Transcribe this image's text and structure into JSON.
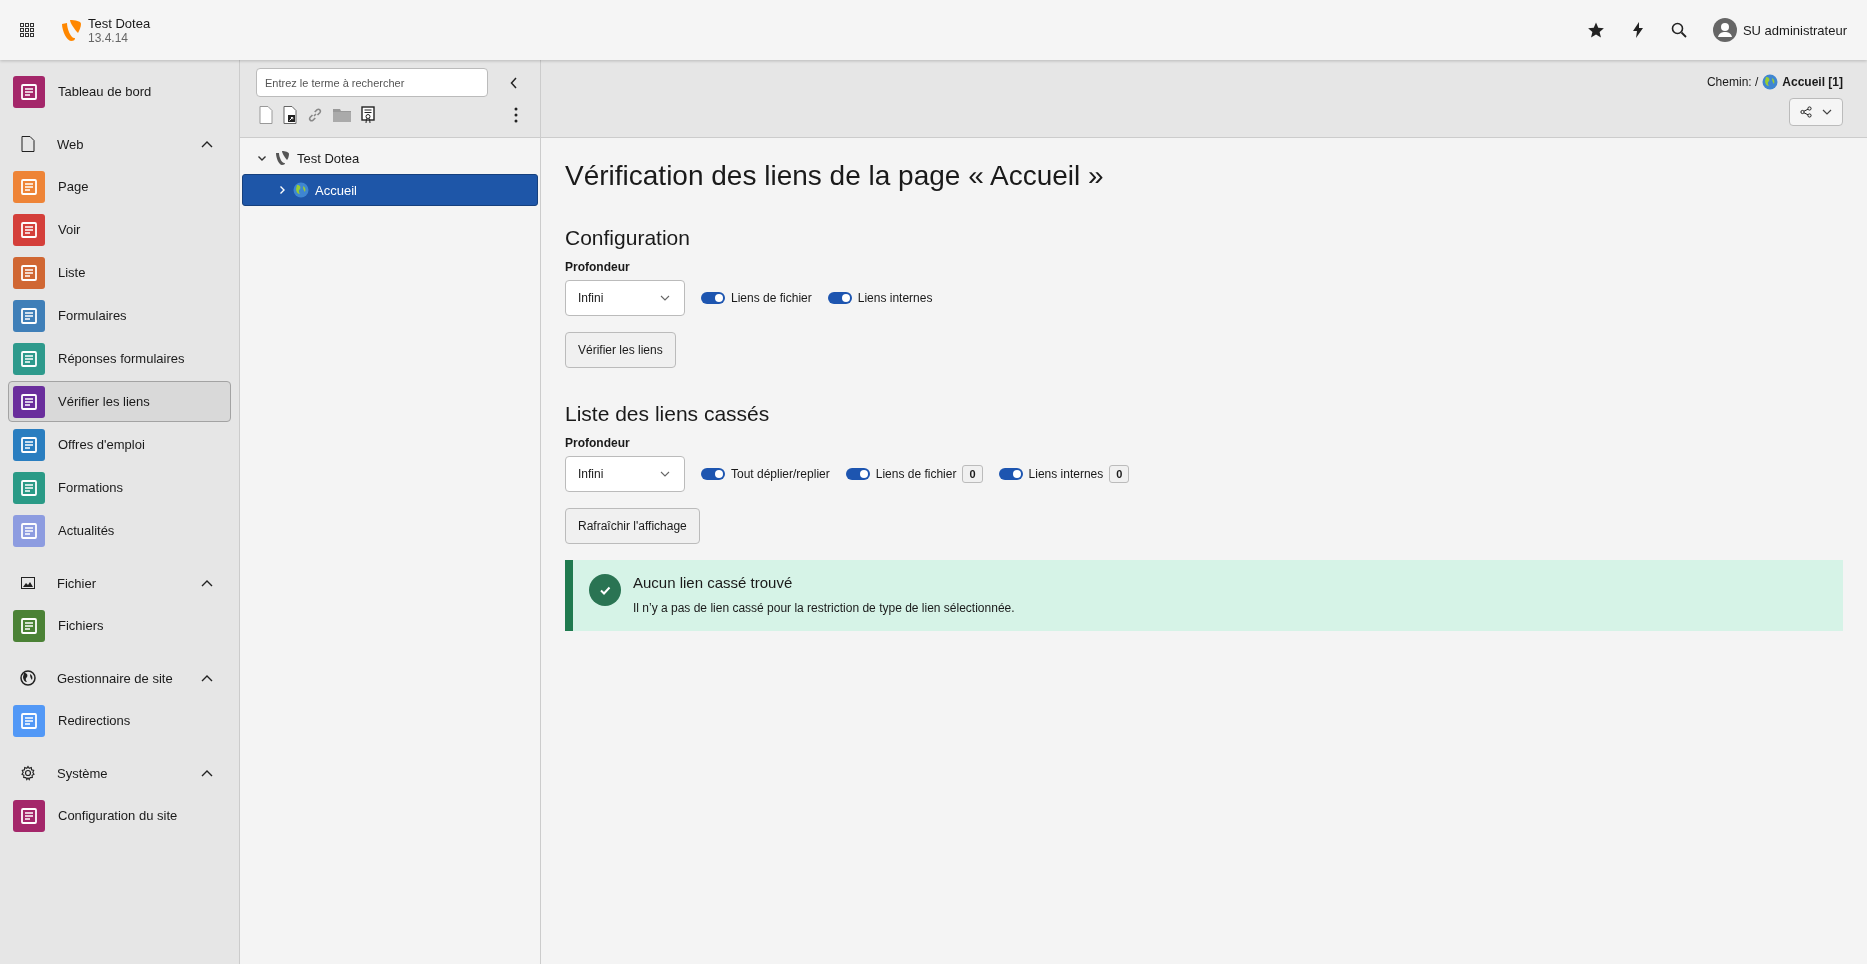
{
  "topbar": {
    "site_name": "Test Dotea",
    "version": "13.4.14",
    "user": "SU administrateur"
  },
  "sidebar": [
    {
      "kind": "module",
      "label": "Tableau de bord",
      "color": "#a4276a",
      "selected": false
    },
    {
      "kind": "group",
      "label": "Web",
      "expanded": true,
      "children": [
        {
          "label": "Page",
          "color": "#ee8437",
          "selected": false
        },
        {
          "label": "Voir",
          "color": "#d43f3a",
          "selected": false
        },
        {
          "label": "Liste",
          "color": "#d06733",
          "selected": false
        },
        {
          "label": "Formulaires",
          "color": "#3f7fb8",
          "selected": false
        },
        {
          "label": "Réponses formulaires",
          "color": "#2e9a8c",
          "selected": false
        },
        {
          "label": "Vérifier les liens",
          "color": "#6a2e9c",
          "selected": true
        },
        {
          "label": "Offres d'emploi",
          "color": "#2a7ec0",
          "selected": false
        },
        {
          "label": "Formations",
          "color": "#2a9a86",
          "selected": false
        },
        {
          "label": "Actualités",
          "color": "#8d9ce0",
          "selected": false
        }
      ]
    },
    {
      "kind": "group",
      "label": "Fichier",
      "expanded": true,
      "children": [
        {
          "label": "Fichiers",
          "color": "#4b8236",
          "selected": false
        }
      ]
    },
    {
      "kind": "group",
      "label": "Gestionnaire de site",
      "expanded": true,
      "children": [
        {
          "label": "Redirections",
          "color": "#5298f6",
          "selected": false
        }
      ]
    },
    {
      "kind": "group",
      "label": "Système",
      "expanded": true,
      "children": [
        {
          "label": "Configuration du site",
          "color": "#a4276a",
          "selected": false
        }
      ]
    }
  ],
  "page_tree": {
    "search": {
      "placeholder": "Entrez le terme à rechercher"
    },
    "nodes": [
      {
        "label": "Test Dotea",
        "expanded": true,
        "selected": false,
        "children": [
          {
            "label": "Accueil",
            "expanded": false,
            "selected": true
          }
        ]
      }
    ]
  },
  "breadcrumb": {
    "prefix": "Chemin: /",
    "page": "Accueil [1]"
  },
  "title": "Vérification des liens de la page « Accueil »",
  "configuration": {
    "heading": "Configuration",
    "depth_label": "Profondeur",
    "depth_value": "Infini",
    "toggles": [
      {
        "label": "Liens de fichier",
        "on": true
      },
      {
        "label": "Liens internes",
        "on": true
      }
    ],
    "button": "Vérifier les liens"
  },
  "broken_links": {
    "heading": "Liste des liens cassés",
    "depth_label": "Profondeur",
    "depth_value": "Infini",
    "toggles": [
      {
        "label": "Tout déplier/replier",
        "on": true
      },
      {
        "label": "Liens de fichier",
        "on": true,
        "count": "0"
      },
      {
        "label": "Liens internes",
        "on": true,
        "count": "0"
      }
    ],
    "button": "Rafraîchir l'affichage",
    "alert": {
      "title": "Aucun lien cassé trouvé",
      "message": "Il n’y a pas de lien cassé pour la restriction de type de lien sélectionnée."
    }
  }
}
